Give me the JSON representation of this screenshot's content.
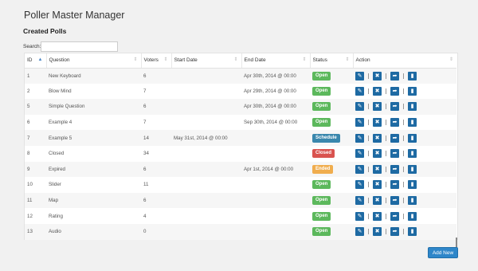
{
  "page": {
    "title": "Poller Master Manager",
    "section_title": "Created Polls"
  },
  "search": {
    "label": "Search:",
    "value": "",
    "placeholder": ""
  },
  "table": {
    "columns": [
      "ID",
      "Question",
      "Voters",
      "Start Date",
      "End Date",
      "Status",
      "Action"
    ],
    "rows": [
      {
        "id": "1",
        "question": "New Keyboard",
        "voters": "6",
        "start": "",
        "end": "Apr 30th, 2014 @ 00:00",
        "status": "Open",
        "status_type": "open"
      },
      {
        "id": "2",
        "question": "Blow Mind",
        "voters": "7",
        "start": "",
        "end": "Apr 29th, 2014 @ 00:00",
        "status": "Open",
        "status_type": "open"
      },
      {
        "id": "5",
        "question": "Simple Question",
        "voters": "6",
        "start": "",
        "end": "Apr 30th, 2014 @ 00:00",
        "status": "Open",
        "status_type": "open"
      },
      {
        "id": "6",
        "question": "Example 4",
        "voters": "7",
        "start": "",
        "end": "Sep 30th, 2014 @ 00:00",
        "status": "Open",
        "status_type": "open"
      },
      {
        "id": "7",
        "question": "Example 5",
        "voters": "14",
        "start": "May 31st, 2014 @ 00:00",
        "end": "",
        "status": "Schedule",
        "status_type": "schedule"
      },
      {
        "id": "8",
        "question": "Closed",
        "voters": "34",
        "start": "",
        "end": "",
        "status": "Closed",
        "status_type": "closed"
      },
      {
        "id": "9",
        "question": "Expired",
        "voters": "6",
        "start": "",
        "end": "Apr 1st, 2014 @ 00:00",
        "status": "Ended",
        "status_type": "ended"
      },
      {
        "id": "10",
        "question": "Slider",
        "voters": "11",
        "start": "",
        "end": "",
        "status": "Open",
        "status_type": "open"
      },
      {
        "id": "11",
        "question": "Map",
        "voters": "6",
        "start": "",
        "end": "",
        "status": "Open",
        "status_type": "open"
      },
      {
        "id": "12",
        "question": "Rating",
        "voters": "4",
        "start": "",
        "end": "",
        "status": "Open",
        "status_type": "open"
      },
      {
        "id": "13",
        "question": "Audio",
        "voters": "0",
        "start": "",
        "end": "",
        "status": "Open",
        "status_type": "open"
      }
    ],
    "actions": [
      {
        "name": "edit-icon",
        "glyph": "✎"
      },
      {
        "name": "delete-icon",
        "glyph": "✖"
      },
      {
        "name": "share-icon",
        "glyph": "➦"
      },
      {
        "name": "stats-icon",
        "glyph": "▮"
      }
    ],
    "sort": {
      "column": "ID",
      "direction": "asc"
    }
  },
  "buttons": {
    "add_new": "Add New"
  },
  "colors": {
    "open": "#5cb85c",
    "schedule": "#3a87ad",
    "closed": "#d9534f",
    "ended": "#f0ad4e",
    "action": "#1e6aa3",
    "add_new": "#2e86c9"
  }
}
